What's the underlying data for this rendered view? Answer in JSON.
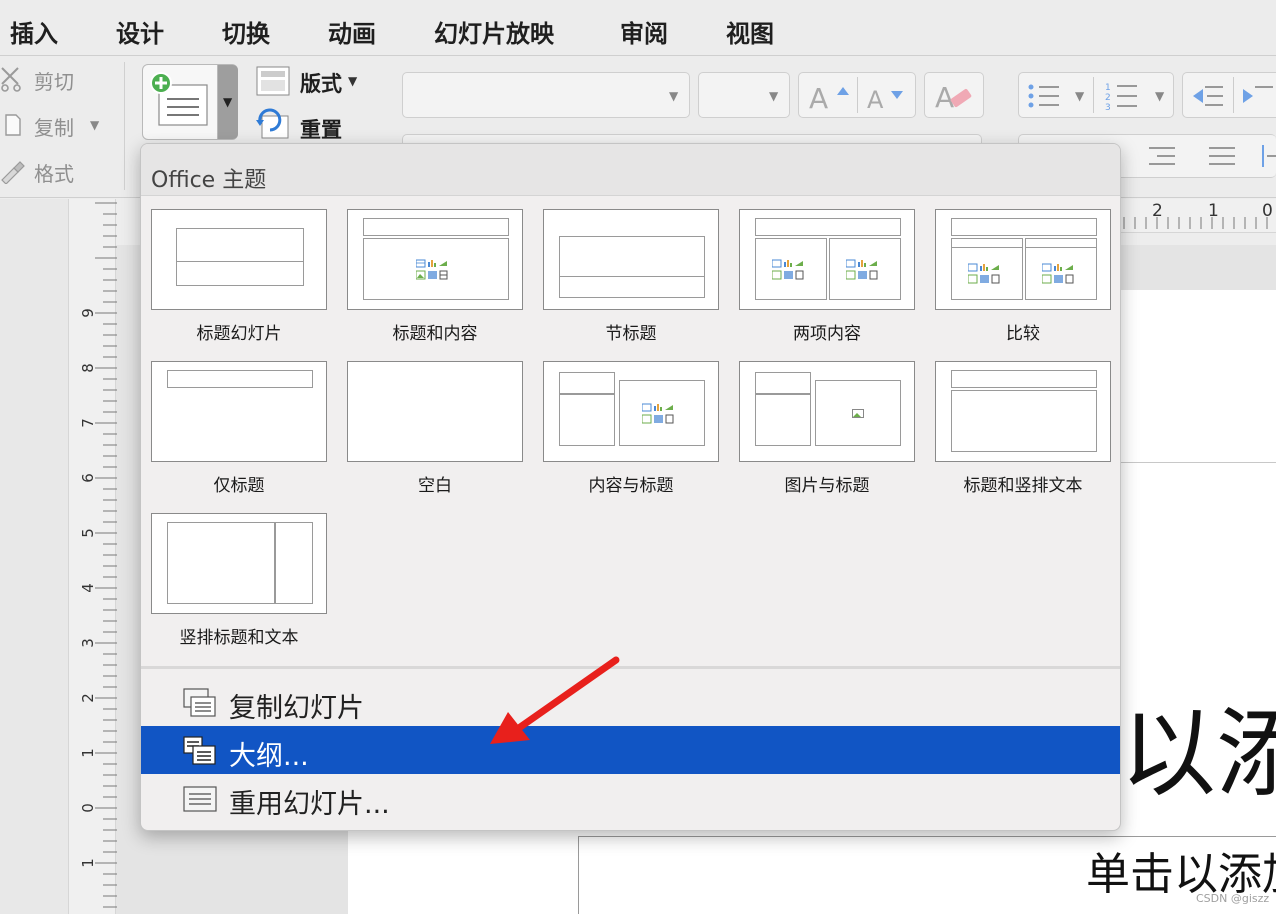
{
  "menubar": {
    "tabs": [
      "插入",
      "设计",
      "切换",
      "动画",
      "幻灯片放映",
      "审阅",
      "视图"
    ]
  },
  "ribbon": {
    "clipboard": {
      "cut_label": "剪切",
      "copy_label": "复制",
      "format_label": "格式"
    },
    "slides": {
      "layout_label": "版式",
      "reset_label": "重置"
    }
  },
  "rulers": {
    "vertical_labels": [
      "9",
      "8",
      "7",
      "6",
      "5",
      "4",
      "3",
      "2",
      "1",
      "0",
      "1"
    ],
    "horizontal_labels": [
      "2",
      "1",
      "0"
    ]
  },
  "slide": {
    "title_partial": "以添",
    "subtitle_partial": "单击以添加"
  },
  "panel": {
    "title": "Office 主题",
    "layouts": [
      {
        "name": "标题幻灯片"
      },
      {
        "name": "标题和内容"
      },
      {
        "name": "节标题"
      },
      {
        "name": "两项内容"
      },
      {
        "name": "比较"
      },
      {
        "name": "仅标题"
      },
      {
        "name": "空白"
      },
      {
        "name": "内容与标题"
      },
      {
        "name": "图片与标题"
      },
      {
        "name": "标题和竖排文本"
      },
      {
        "name": "竖排标题和文本"
      }
    ],
    "commands": [
      {
        "label": "复制幻灯片"
      },
      {
        "label": "大纲..."
      },
      {
        "label": "重用幻灯片..."
      }
    ],
    "selected_command": "大纲..."
  },
  "watermark": "CSDN @giszz",
  "colors": {
    "selection": "#1155c4",
    "arrow": "#e8201c",
    "add_badge": "#4caf50"
  }
}
